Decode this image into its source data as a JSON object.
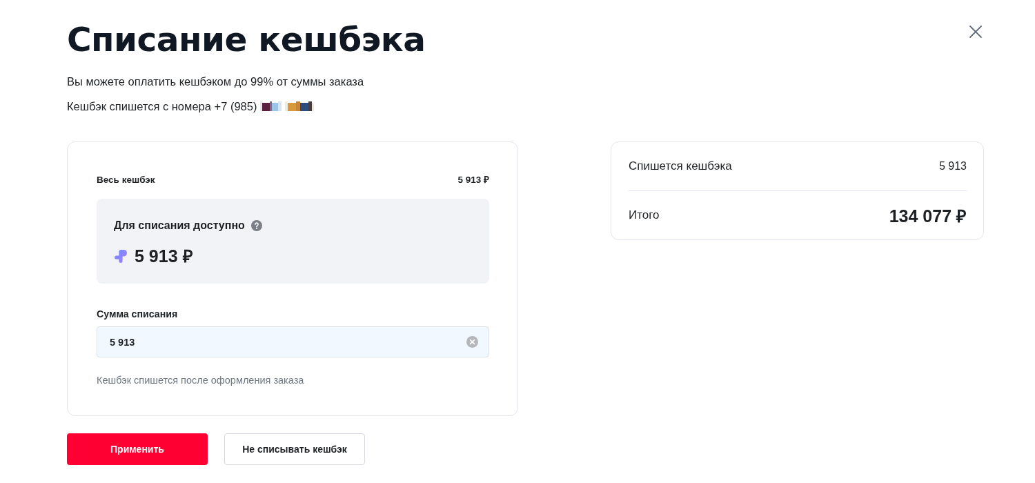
{
  "dialog": {
    "title": "Списание кешбэка",
    "info": "Вы можете оплатить кешбэком до 99% от суммы заказа",
    "phone_line": {
      "text": "Кешбэк спишется с номера +7 (985)",
      "redacted": true
    }
  },
  "balance": {
    "label": "Весь кешбэк",
    "value": "5 913 ₽"
  },
  "available": {
    "label": "Для списания доступно",
    "amount": "5 913 ₽"
  },
  "amount_field": {
    "label": "Сумма списания",
    "value": "5 913",
    "hint": "Кешбэк спишется после оформления заказа"
  },
  "buttons": [
    {
      "label": "Применить",
      "kind": "primary"
    },
    {
      "label": "Не списывать кешбэк",
      "kind": "secondary"
    }
  ],
  "summary": {
    "rows": [
      {
        "label": "Спишется кешбэка",
        "value": "5 913",
        "kind": "normal"
      },
      {
        "label": "Итого",
        "value": "134 077 ₽",
        "kind": "total"
      }
    ]
  }
}
